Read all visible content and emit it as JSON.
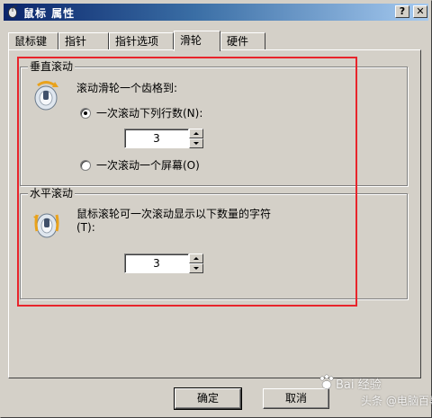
{
  "window": {
    "title": "鼠标 属性",
    "help_button": "?",
    "close_button": "✕"
  },
  "tabs": [
    {
      "label": "鼠标键",
      "active": false
    },
    {
      "label": "指针",
      "active": false
    },
    {
      "label": "指针选项",
      "active": false
    },
    {
      "label": "滑轮",
      "active": true
    },
    {
      "label": "硬件",
      "active": false
    }
  ],
  "vertical_scroll": {
    "legend": "垂直滚动",
    "instruction": "滚动滑轮一个齿格到:",
    "option_lines_label": "一次滚动下列行数(N):",
    "lines_value": "3",
    "option_screen_label": "一次滚动一个屏幕(O)",
    "selected": "lines"
  },
  "horizontal_scroll": {
    "legend": "水平滚动",
    "instruction_line1": "鼠标滚轮可一次滚动显示以下数量的字符",
    "instruction_line2": "(T):",
    "chars_value": "3"
  },
  "buttons": {
    "ok": "确定",
    "cancel": "取消"
  },
  "watermark": {
    "line1": "Bai 经验",
    "line2": "头条 @电脑百事"
  },
  "colors": {
    "highlight_box": "#e8242b",
    "titlebar_start": "#0a246a",
    "titlebar_end": "#a6caf0",
    "face": "#d4d0c8"
  }
}
